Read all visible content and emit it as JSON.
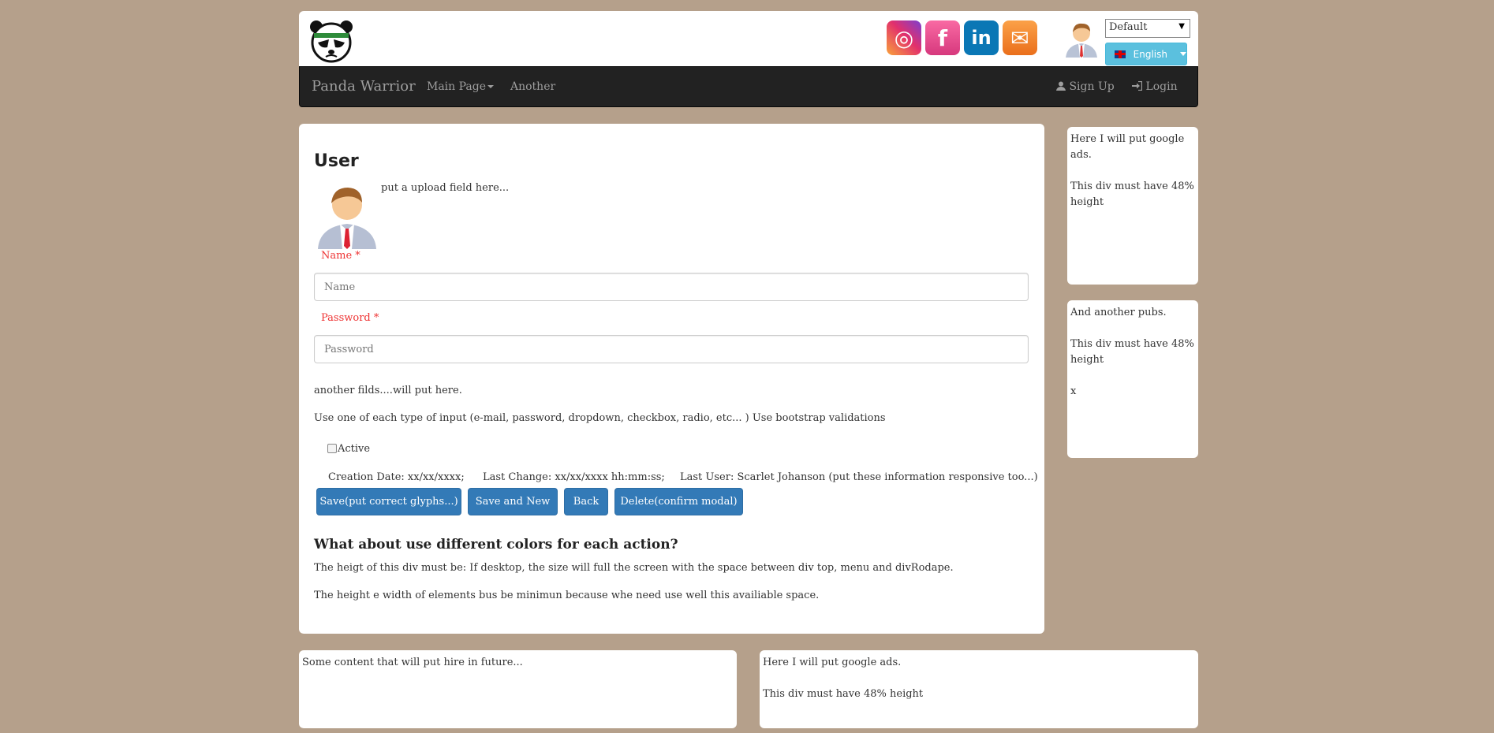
{
  "header": {
    "social": [
      {
        "name": "instagram-icon",
        "glyph": "◎"
      },
      {
        "name": "facebook-icon",
        "glyph": "f"
      },
      {
        "name": "linkedin-icon",
        "glyph": "in"
      },
      {
        "name": "mail-icon",
        "glyph": "✉"
      }
    ],
    "theme_select": "Default",
    "language": "English"
  },
  "navbar": {
    "brand": "Panda Warrior",
    "main_page": "Main Page",
    "another": "Another",
    "sign_up": "Sign Up",
    "login": "Login"
  },
  "main": {
    "title": "User",
    "upload_text": "put a upload field here...",
    "name_label": "Name *",
    "name_placeholder": "Name",
    "password_label": "Password *",
    "password_placeholder": "Password",
    "another_fields": "another filds....will put here.",
    "input_types": "Use one of each type of input (e-mail, password, dropdown, checkbox, radio, etc... ) Use bootstrap validations",
    "active_label": "Active",
    "active_checked": false,
    "creation_date": "Creation Date: xx/xx/xxxx;",
    "last_change": "Last Change: xx/xx/xxxx hh:mm:ss;",
    "last_user": "Last User: Scarlet Johanson (put these information responsive too...)",
    "buttons": {
      "save": "Save(put correct glyphs...)",
      "save_new": "Save and New",
      "back": "Back",
      "delete": "Delete(confirm modal)"
    },
    "subheading": "What about use different colors for each action?",
    "height_note_1": "The heigt of this div must be: If desktop, the size will full the screen with the space between div top, menu and divRodape.",
    "height_note_2": "The height e width of elements bus be minimun because whe need use well this availiable space."
  },
  "ads": {
    "right_1": {
      "line1": "Here I will put google ads.",
      "line2": "This div must have 48% height"
    },
    "right_2": {
      "line1": "And another pubs.",
      "line2": "This div must have 48% height",
      "line3": "x"
    },
    "bottom_1": {
      "line1": "Some content that will put hire in future..."
    },
    "bottom_2": {
      "line1": "Here I will put google ads.",
      "line2": "This div must have 48% height"
    }
  },
  "colors": {
    "background": "#b5a08b",
    "navbar": "#222222",
    "primary_button": "#337ab7",
    "info_button": "#5bc0de",
    "required_label": "#ee3333"
  }
}
